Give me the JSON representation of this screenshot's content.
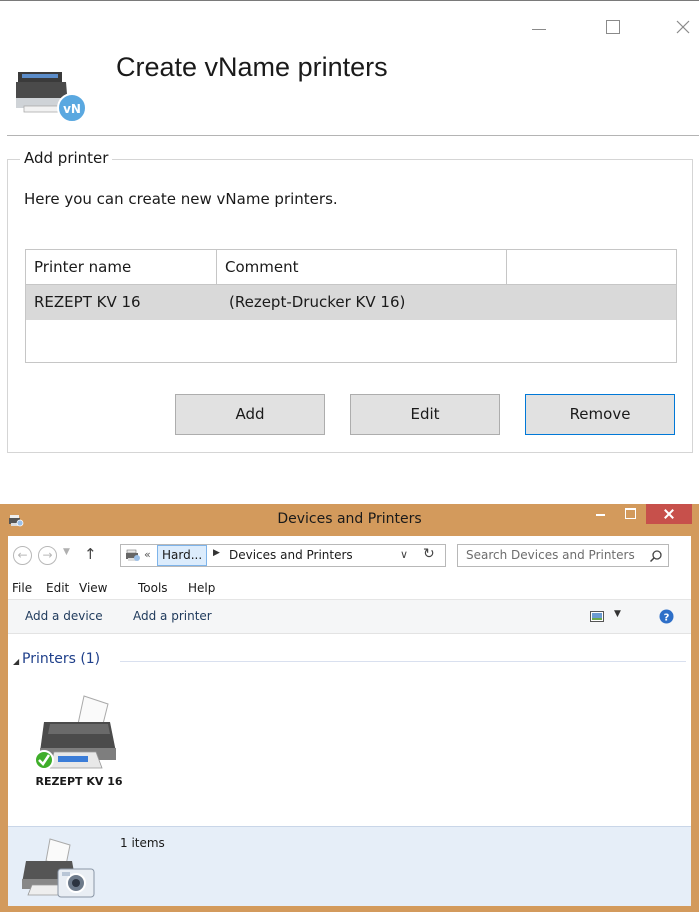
{
  "dialog": {
    "title": "Create vName printers",
    "group_label": "Add printer",
    "description": "Here you can create new vName printers.",
    "table": {
      "headers": [
        "Printer name",
        "Comment",
        ""
      ],
      "rows": [
        {
          "name": "REZEPT KV 16",
          "comment": "(Rezept-Drucker KV 16)"
        }
      ]
    },
    "buttons": {
      "add": "Add",
      "edit": "Edit",
      "remove": "Remove"
    },
    "badge_text": "vN"
  },
  "explorer": {
    "title": "Devices and Printers",
    "address": {
      "crumb_collapsed": "«",
      "crumb1": "Hard...",
      "crumb2": "Devices and Printers"
    },
    "search_placeholder": "Search Devices and Printers",
    "menu": [
      "File",
      "Edit",
      "View",
      "Tools",
      "Help"
    ],
    "commands": {
      "add_device": "Add a device",
      "add_printer": "Add a printer"
    },
    "group": {
      "header": "Printers (1)"
    },
    "items": [
      {
        "label": "REZEPT KV 16",
        "icon": "printer-icon",
        "default": true
      }
    ],
    "details": {
      "count": "1 items"
    }
  },
  "colors": {
    "window_frame": "#d39a5c",
    "close_button": "#c7504b",
    "selected_row": "#d9d9d9",
    "accent_button_border": "#0078d7",
    "group_header": "#1e3f8a",
    "details_pane": "#e6eef8"
  }
}
